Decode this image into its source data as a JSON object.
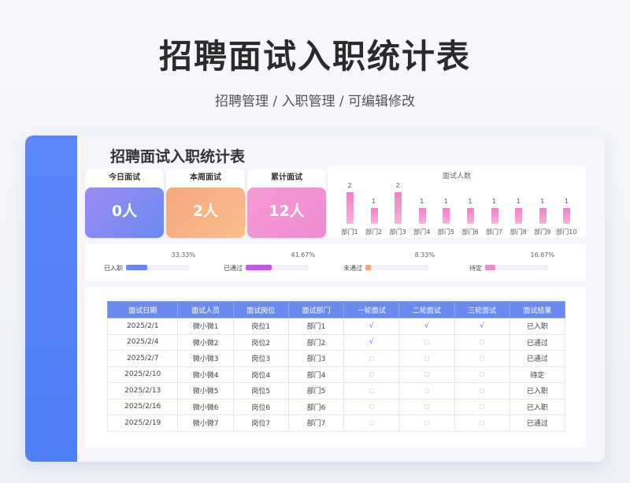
{
  "hero": {
    "title": "招聘面试入职统计表",
    "subtitle": "招聘管理 / 入职管理 /  可编辑修改"
  },
  "sheet": {
    "title": "招聘面试入职统计表"
  },
  "stats": [
    {
      "label": "今日面试",
      "value": "0人",
      "color": "#7b8ef5"
    },
    {
      "label": "本周面试",
      "value": "2人",
      "color": "#f7a77c"
    },
    {
      "label": "累计面试",
      "value": "12人",
      "color": "#f08bd0"
    }
  ],
  "chart_data": {
    "type": "bar",
    "title": "面试人数",
    "categories": [
      "部门1",
      "部门2",
      "部门3",
      "部门4",
      "部门5",
      "部门6",
      "部门7",
      "部门8",
      "部门9",
      "部门10"
    ],
    "values": [
      2,
      1,
      2,
      1,
      1,
      1,
      1,
      1,
      1,
      1
    ],
    "ylim": [
      0,
      2
    ],
    "grid": false,
    "color": "#f47ec8"
  },
  "progress": [
    {
      "label": "已入职",
      "pct_text": "33.33%",
      "value": 0.3333,
      "color": "#6a86f2"
    },
    {
      "label": "已通过",
      "pct_text": "41.67%",
      "value": 0.4167,
      "color": "#c55be0"
    },
    {
      "label": "未通过",
      "pct_text": "8.33%",
      "value": 0.0833,
      "color": "#f5a37c"
    },
    {
      "label": "待定",
      "pct_text": "16.67%",
      "value": 0.1667,
      "color": "#f08bd0"
    }
  ],
  "table": {
    "headers": [
      "面试日期",
      "面试人员",
      "面试岗位",
      "面试部门",
      "一轮面试",
      "二轮面试",
      "三轮面试",
      "面试结果"
    ],
    "check_mark": "√",
    "empty_mark": "□",
    "rows": [
      [
        "2025/2/1",
        "微小微1",
        "岗位1",
        "部门1",
        "√",
        "√",
        "√",
        "已入职"
      ],
      [
        "2025/2/4",
        "微小微2",
        "岗位2",
        "部门2",
        "√",
        "□",
        "□",
        "已通过"
      ],
      [
        "2025/2/7",
        "微小微3",
        "岗位3",
        "部门3",
        "□",
        "□",
        "□",
        "已通过"
      ],
      [
        "2025/2/10",
        "微小微4",
        "岗位4",
        "部门4",
        "□",
        "□",
        "□",
        "待定"
      ],
      [
        "2025/2/13",
        "微小微5",
        "岗位5",
        "部门5",
        "□",
        "□",
        "□",
        "已入职"
      ],
      [
        "2025/2/16",
        "微小微6",
        "岗位6",
        "部门6",
        "□",
        "□",
        "□",
        "已入职"
      ],
      [
        "2025/2/19",
        "微小微7",
        "岗位7",
        "部门7",
        "□",
        "□",
        "□",
        "已通过"
      ]
    ]
  }
}
